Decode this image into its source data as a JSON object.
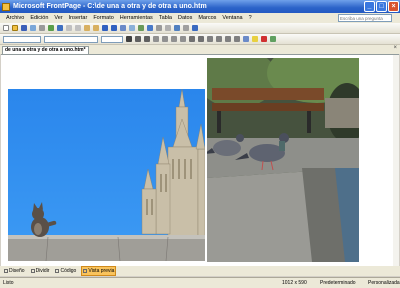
{
  "window": {
    "title": "Microsoft FrontPage - C:\\de una a otra y de otra a uno.htm"
  },
  "menu": {
    "items": [
      "Archivo",
      "Edición",
      "Ver",
      "Insertar",
      "Formato",
      "Herramientas",
      "Tabla",
      "Datos",
      "Marcos",
      "Ventana",
      "?"
    ],
    "help_placeholder": "Escriba una pregunta"
  },
  "document": {
    "tab_label": "de una a otra y de otra a uno.htm*"
  },
  "views": {
    "tabs": [
      "Diseño",
      "Dividir",
      "Código",
      "Vista previa"
    ],
    "active": "Vista previa"
  },
  "status": {
    "left": "Listo",
    "size": "1012 x 590",
    "mode": "Predeterminado",
    "style": "Personalizada"
  },
  "images": {
    "left": {
      "subject": "cat-on-wall-with-cathedral-spires"
    },
    "right": {
      "subject": "pigeons-on-ledge"
    }
  },
  "colors": {
    "title_bar": "#2b63c9",
    "active_view": "#f9c35c",
    "sky": "#2e8ef0"
  }
}
